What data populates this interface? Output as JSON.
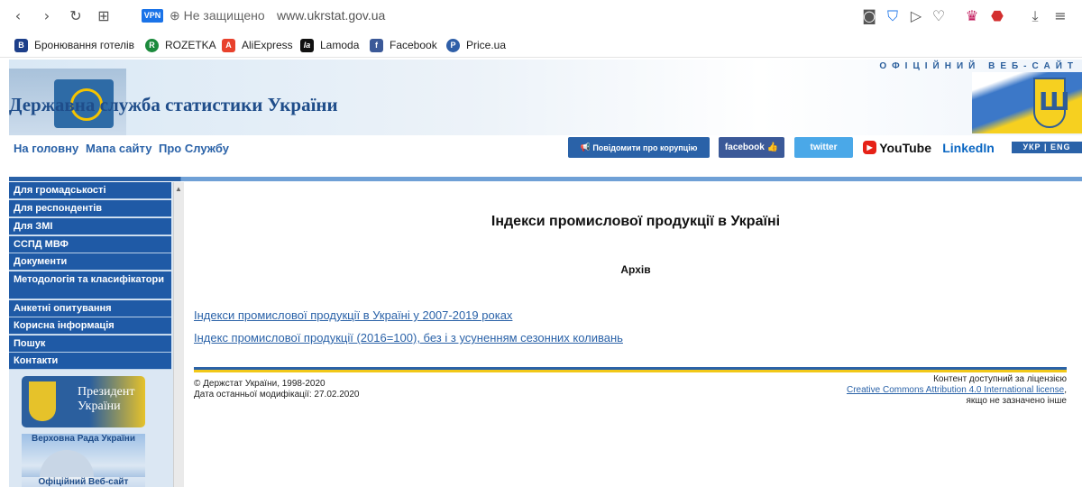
{
  "browser": {
    "vpn": "VPN",
    "security": "Не защищено",
    "url": "www.ukrstat.gov.ua",
    "bookmarks": [
      {
        "label": "Бронювання готелів",
        "icon": "B"
      },
      {
        "label": "ROZETKA",
        "icon": "R"
      },
      {
        "label": "AliExpress",
        "icon": "A"
      },
      {
        "label": "Lamoda",
        "icon": "la"
      },
      {
        "label": "Facebook",
        "icon": "f"
      },
      {
        "label": "Price.ua",
        "icon": "P"
      }
    ]
  },
  "header": {
    "official": "ОФІЦІЙНИЙ ВЕБ-САЙТ",
    "title": "Державна служба статистики України",
    "nav": [
      "На головну",
      "Мапа сайту",
      "Про Службу"
    ],
    "social": {
      "corruption": "Повідомити про корупцію",
      "facebook": "facebook",
      "twitter": "twitter",
      "youtube": "YouTube",
      "linkedin": "LinkedIn"
    },
    "lang": "УКР | ENG"
  },
  "sidebar": {
    "items": [
      "Для громадськості",
      "Для респондентів",
      "Для ЗМІ",
      "ССПД МВФ",
      "Документи",
      "Методологія та класифікатори",
      "Анкетні опитування",
      "Корисна інформація",
      "Пошук",
      "Контакти"
    ],
    "promo_president": "Президент України",
    "promo_rada_top": "Верховна Рада України",
    "promo_rada_bottom": "Офіційний Веб-сайт"
  },
  "main": {
    "title": "Індекси промислової продукції в Україні",
    "subtitle": "Архів",
    "links": [
      "Індекси промислової продукції в Україні у 2007-2019 роках",
      "Індекс промислової продукції (2016=100), без і з усуненням сезонних коливань"
    ]
  },
  "footer": {
    "copyright": "© Держстат України, 1998-2020",
    "modified": "Дата останньої модифікації: 27.02.2020",
    "license_prefix": "Контент доступний за ліцензією",
    "license_link": "Creative Commons Attribution 4.0 International license",
    "license_suffix": "якщо не зазначено інше"
  }
}
